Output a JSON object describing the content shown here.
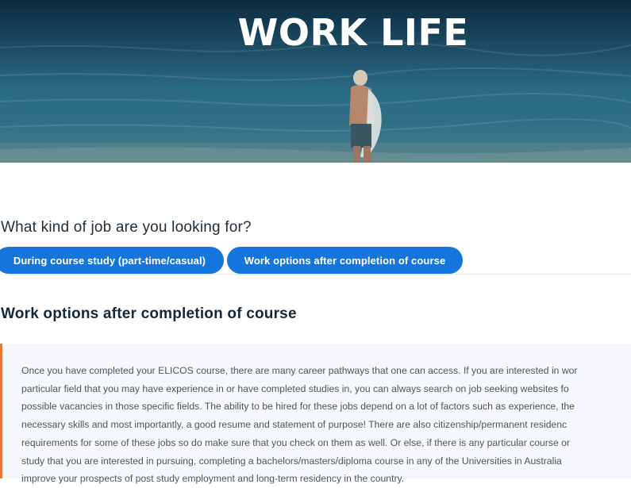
{
  "hero": {
    "title": "WORK LIFE"
  },
  "job_search": {
    "question": "What kind of job are you looking for?",
    "tabs": [
      {
        "label": "During course study (part-time/casual)"
      },
      {
        "label": "Work options after completion of course"
      }
    ],
    "active_tab": 1
  },
  "section": {
    "title": "Work options after completion of course",
    "body_lines": [
      "Once you have completed your ELICOS course, there are many career pathways that one can access. If you are interested in wor",
      "particular field that you may have experience in or have completed studies in, you can always search on job seeking websites fo",
      "possible vacancies in those specific fields. The ability to be hired for these jobs depend on a lot of factors such as experience, the",
      "necessary skills and most importantly, a good resume and statement of purpose! There are also citizenship/permanent residenc",
      "requirements for some of these jobs so do make sure that you check on them as well. Or else, if there is any particular course or",
      "study that you are interested in pursuing, completing a bachelors/masters/diploma course in any of the Universities in Australia",
      "improve your prospects of post study employment and long-term residency in the country."
    ]
  },
  "colors": {
    "tab_bg": "#1476dc",
    "accent_border": "#e07b39",
    "panel_bg": "#f6f7fb"
  }
}
